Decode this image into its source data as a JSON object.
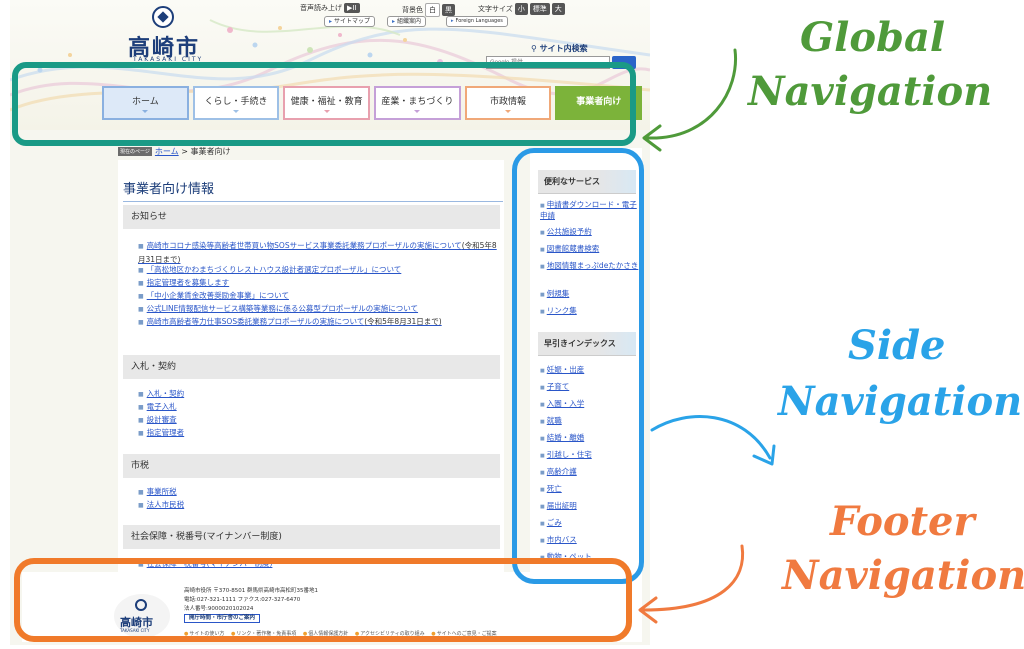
{
  "header": {
    "logo_text": "高崎市",
    "logo_sub": "TAKASAKI CITY",
    "utility": {
      "read_aloud_label": "音声読み上げ",
      "read_aloud_btn": "▶II",
      "bg_color_label": "背景色",
      "bg_white": "白",
      "bg_black": "黒",
      "font_size_label": "文字サイズ",
      "size_small": "小",
      "size_standard": "標準",
      "size_large": "大"
    },
    "links": {
      "sitemap": "サイトマップ",
      "org_guide": "組織案内",
      "foreign_languages": "Foreign Languages"
    },
    "search": {
      "label": "サイト内検索",
      "placeholder": "Google 提供"
    }
  },
  "global_nav": {
    "items": [
      "ホーム",
      "くらし・手続き",
      "健康・福祉・教育",
      "産業・まちづくり",
      "市政情報",
      "事業者向け"
    ]
  },
  "breadcrumb": {
    "here_label": "現在のページ",
    "home": "ホーム",
    "separator": ">",
    "current": "事業者向け"
  },
  "main": {
    "title": "事業者向け情報",
    "sections": [
      {
        "heading": "お知らせ",
        "links": [
          {
            "text": "高崎市コロナ感染等高齢者世帯買い物SOSサービス事業委託業務プロポーザルの実施について",
            "note": "(令和5年8月31日まで)"
          },
          {
            "text": "「高松地区かわまちづくりレストハウス設計者選定プロポーザル」について",
            "note": ""
          },
          {
            "text": "指定管理者を募集します",
            "note": ""
          },
          {
            "text": "「中小企業賃金改善奨励金事業」について",
            "note": ""
          },
          {
            "text": "公式LINE情報配信サービス構築等業務に係る公募型プロポーザルの実施について",
            "note": ""
          },
          {
            "text": "高崎市高齢者等力仕事SOS委託業務プロポーザルの実施について",
            "note": "(令和5年8月31日まで)"
          }
        ]
      },
      {
        "heading": "入札・契約",
        "links": [
          {
            "text": "入札・契約",
            "note": ""
          },
          {
            "text": "電子入札",
            "note": ""
          },
          {
            "text": "設計審査",
            "note": ""
          },
          {
            "text": "指定管理者",
            "note": ""
          }
        ]
      },
      {
        "heading": "市税",
        "links": [
          {
            "text": "事業所税",
            "note": ""
          },
          {
            "text": "法人市民税",
            "note": ""
          }
        ]
      },
      {
        "heading": "社会保障・税番号(マイナンバー制度)",
        "links": [
          {
            "text": "社会保障・税番号(マイナンバー制度)",
            "note": ""
          }
        ]
      }
    ]
  },
  "side_nav": {
    "services_heading": "便利なサービス",
    "services": [
      "申請書ダウンロード・電子申請",
      "公共施設予約",
      "図書館蔵書検索",
      "地図情報まっぷdeたかさき",
      "例規集",
      "リンク集"
    ],
    "index_heading": "早引きインデックス",
    "index": [
      "妊娠・出産",
      "子育て",
      "入園・入学",
      "就職",
      "結婚・離婚",
      "引越し・住宅",
      "高齢介護",
      "死亡",
      "届出証明",
      "ごみ",
      "市内バス",
      "動物・ペット"
    ]
  },
  "footer": {
    "logo_text": "高崎市",
    "logo_sub": "TAKASAKI CITY",
    "address": "高崎市役所 〒370-8501 群馬県高崎市高松町35番地1",
    "phone": "電話:027-321-1111 ファクス:027-327-6470",
    "corp_no": "法人番号:9000020102024",
    "hours_btn": "開庁時間・市庁舎のご案内",
    "links": [
      "サイトの使い方",
      "リンク・著作権・免責事項",
      "個人情報保護方針",
      "アクセシビリティの取り組み",
      "サイトへのご意見・ご提案"
    ]
  },
  "annotations": {
    "global": [
      "Global",
      "Navigation"
    ],
    "side": [
      "Side",
      "Navigation"
    ],
    "footer": [
      "Footer",
      "Navigation"
    ]
  },
  "colors": {
    "global_ring": "#1a9a86",
    "global_text": "#4f9a3a",
    "side_ring": "#2a9ae6",
    "side_text": "#2aa3e8",
    "footer_ring": "#f07a2a",
    "footer_text": "#f07a40",
    "accent": "#1d3e7a",
    "link": "#2a56c8"
  }
}
